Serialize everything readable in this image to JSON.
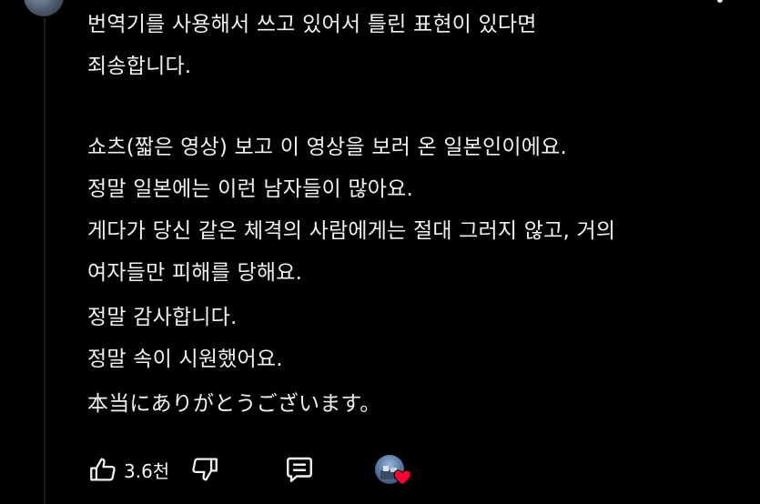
{
  "comment": {
    "lines": [
      "번역기를 사용해서 쓰고 있어서 틀린 표현이 있다면",
      "죄송합니다.",
      "",
      "쇼츠(짧은 영상) 보고 이 영상을 보러 온 일본인이에요.",
      "정말 일본에는 이런 남자들이 많아요.",
      "게다가 당신 같은 체격의 사람에게는 절대 그러지 않고, 거의",
      "여자들만 피해를 당해요.",
      "정말 감사합니다.",
      "정말 속이 시원했어요.",
      "本当にありがとうございます。"
    ]
  },
  "actions": {
    "like_count": "3.6천",
    "like_icon": "thumbs-up-icon",
    "dislike_icon": "thumbs-down-icon",
    "reply_icon": "reply-comment-icon",
    "creator_heart_icon": "creator-heart-icon"
  },
  "colors": {
    "background": "#000000",
    "text": "#f1f1f1",
    "heart": "#ff0033"
  }
}
